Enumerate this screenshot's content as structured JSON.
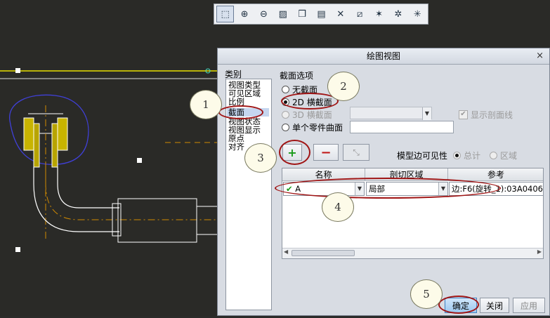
{
  "toolbar": {
    "icons": [
      "zoom-fit-icon",
      "zoom-in-icon",
      "zoom-out-icon",
      "repaint-icon",
      "orient-icon",
      "saved-views-icon",
      "datum-planes-icon",
      "datum-axes-icon",
      "datum-points-icon",
      "csys-icon",
      "annotation-icon"
    ]
  },
  "dialog": {
    "title": "绘图视图",
    "close": "×",
    "category_label": "类别",
    "categories": [
      "视图类型",
      "可见区域",
      "比例",
      "截面",
      "视图状态",
      "视图显示",
      "原点",
      "对齐"
    ],
    "selected_category": "截面",
    "section_options_label": "截面选项",
    "options": {
      "none": "无截面",
      "cross2d": "2D 横截面",
      "cross3d": "3D 横截面",
      "single_part": "单个零件曲面"
    },
    "show_xhatch_label": "显示剖面线",
    "add_btn": "+",
    "remove_btn": "−",
    "model_edge_label": "模型边可见性",
    "edge_total": "总计",
    "edge_area": "区域",
    "table": {
      "columns": [
        "名称",
        "剖切区域",
        "参考"
      ],
      "rows": [
        {
          "name": "A",
          "area": "局部",
          "ref": "边:F6(旋转_1):03A0406"
        }
      ]
    },
    "buttons": {
      "ok": "确定",
      "close": "关闭",
      "apply": "应用"
    }
  },
  "callouts": [
    "1",
    "2",
    "3",
    "4",
    "5"
  ],
  "colors": {
    "accent": "#a01515",
    "bubble": "#fdfbe9",
    "cad_bg": "#2a2a27",
    "yellow": "#e8e000"
  }
}
